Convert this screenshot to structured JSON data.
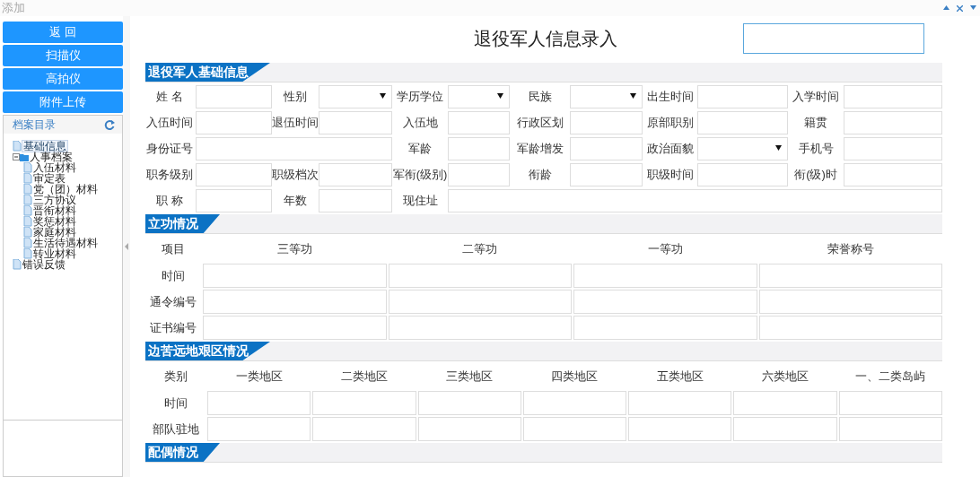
{
  "window": {
    "title": "添加"
  },
  "sidebar": {
    "buttons": [
      "返 回",
      "扫描仪",
      "高拍仪",
      "附件上传"
    ],
    "tree_title": "档案目录",
    "tree": [
      {
        "label": "基础信息",
        "selected": true
      },
      {
        "label": "人事档案",
        "selected": false,
        "expanded": true,
        "children": [
          {
            "label": "入伍材料",
            "selected": false
          },
          {
            "label": "审定表",
            "selected": false
          },
          {
            "label": "党（团）材料",
            "selected": false
          },
          {
            "label": "三方协议",
            "selected": false
          },
          {
            "label": "晋衔材料",
            "selected": false
          },
          {
            "label": "奖惩材料",
            "selected": false
          },
          {
            "label": "家庭材料",
            "selected": false
          },
          {
            "label": "生活待遇材料",
            "selected": false
          },
          {
            "label": "转业材料",
            "selected": false
          }
        ]
      },
      {
        "label": "错误反馈",
        "selected": false
      }
    ]
  },
  "form": {
    "title": "退役军人信息录入",
    "sections": [
      {
        "kind": "fields",
        "title": "退役军人基础信息",
        "rows": [
          [
            {
              "label": "姓 名",
              "kind": "input"
            },
            {
              "label": "性别",
              "kind": "select"
            },
            {
              "label": "学历学位",
              "kind": "select"
            },
            {
              "label": "民族",
              "kind": "select"
            },
            {
              "label": "出生时间",
              "kind": "input"
            },
            {
              "label": "入学时间",
              "kind": "input"
            }
          ],
          [
            {
              "label": "入伍时间",
              "kind": "input"
            },
            {
              "label": "退伍时间",
              "kind": "input"
            },
            {
              "label": "入伍地",
              "kind": "input"
            },
            {
              "label": "行政区划",
              "kind": "input"
            },
            {
              "label": "原部职别",
              "kind": "input"
            },
            {
              "label": "籍贯",
              "kind": "input"
            }
          ],
          [
            {
              "label": "身份证号",
              "kind": "wide"
            },
            {
              "kind": "continued"
            },
            {
              "label": "军龄",
              "kind": "input"
            },
            {
              "label": "军龄增发",
              "kind": "input"
            },
            {
              "label": "政治面貌",
              "kind": "select"
            },
            {
              "label": "手机号",
              "kind": "input"
            }
          ],
          [
            {
              "label": "职务级别",
              "kind": "input"
            },
            {
              "label": "职级档次",
              "kind": "input"
            },
            {
              "label": "军衔(级别)",
              "kind": "input"
            },
            {
              "label": "衔龄",
              "kind": "input"
            },
            {
              "label": "职级时间",
              "kind": "input"
            },
            {
              "label": "衔(级)时",
              "kind": "input"
            }
          ],
          [
            {
              "label": "职 称",
              "kind": "input"
            },
            {
              "label": "年数",
              "kind": "input"
            },
            {
              "label": "现住址",
              "kind": "wide"
            },
            {
              "kind": "continued"
            },
            {
              "kind": "continued"
            },
            {
              "kind": "continued"
            }
          ]
        ]
      },
      {
        "kind": "grid",
        "title": "立功情况",
        "corner": "项目",
        "columns": [
          "三等功",
          "二等功",
          "一等功",
          "荣誉称号"
        ],
        "rows": [
          "时间",
          "通令编号",
          "证书编号"
        ]
      },
      {
        "kind": "grid",
        "title": "边苦远地艰区情况",
        "corner": "类别",
        "columns": [
          "一类地区",
          "二类地区",
          "三类地区",
          "四类地区",
          "五类地区",
          "六类地区",
          "一、二类岛屿"
        ],
        "rows": [
          "时间",
          "部队驻地"
        ]
      },
      {
        "kind": "empty",
        "title": "配偶情况"
      }
    ]
  }
}
